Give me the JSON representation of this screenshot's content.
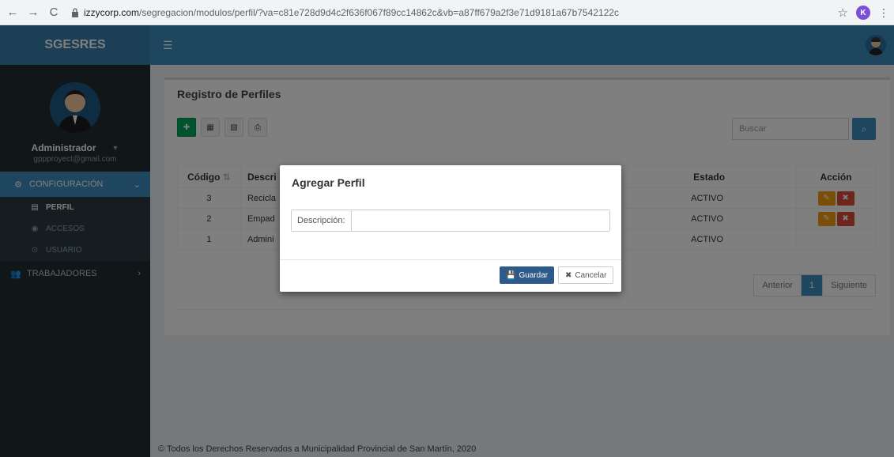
{
  "browser": {
    "url_host": "izzycorp.com",
    "url_path": "/segregacion/modulos/perfil/?va=c81e728d9d4c2f636f067f89cc14862c&vb=a87ff679a2f3e71d9181a67b7542122c",
    "profile_initial": "K"
  },
  "header": {
    "logo": "SGESRES",
    "toggle_icon": "menu-icon"
  },
  "sidebar": {
    "user_name": "Administrador",
    "user_email": "gppproyect@gmail.com",
    "sections": [
      {
        "label": "CONFIGURACIÓN",
        "icon": "gear-icon"
      },
      {
        "label": "TRABAJADORES",
        "icon": "users-icon"
      }
    ],
    "subitems": [
      {
        "label": "PERFIL",
        "icon": "id-card-icon"
      },
      {
        "label": "ACCESOS",
        "icon": "eye-icon"
      },
      {
        "label": "USUARIO",
        "icon": "user-circle-icon"
      }
    ]
  },
  "main": {
    "title": "Registro de Perfiles",
    "search_placeholder": "Buscar",
    "columns": [
      "Código",
      "Descri",
      "Estado",
      "Acción"
    ],
    "rows": [
      {
        "code": "3",
        "desc": "Recicla",
        "estado": "ACTIVO"
      },
      {
        "code": "2",
        "desc": "Empad",
        "estado": "ACTIVO"
      },
      {
        "code": "1",
        "desc": "Admini",
        "estado": "ACTIVO"
      }
    ],
    "pager": {
      "prev": "Anterior",
      "page": "1",
      "next": "Siguiente"
    }
  },
  "footer": "© Todos los Derechos Reservados a Municipalidad Provincial de San Martín, 2020",
  "modal": {
    "title": "Agregar Perfil",
    "label": "Descripción:",
    "value": "",
    "save": "Guardar",
    "cancel": "Cancelar"
  },
  "colors": {
    "primary": "#3c8dbc",
    "sidebar": "#222d32",
    "success": "#00a65a",
    "warning": "#f39c12",
    "danger": "#dd4b39",
    "save_button": "#2c5a8a"
  }
}
